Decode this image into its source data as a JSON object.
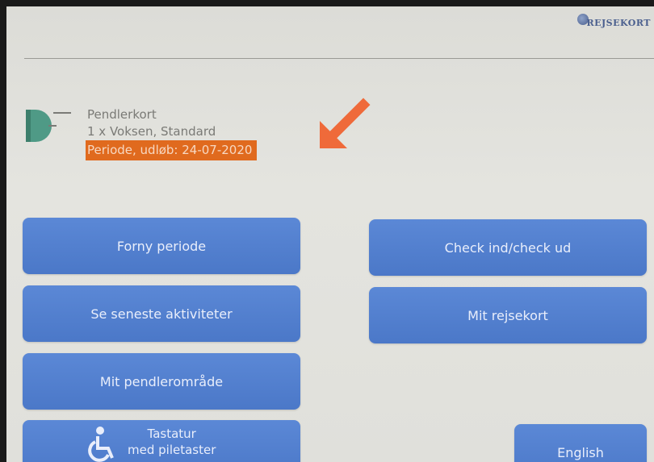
{
  "header": {
    "logo_text": "REJSEKORT"
  },
  "card": {
    "line1": "Pendlerkort",
    "line2": "1 x Voksen, Standard",
    "period": "Periode, udløb: 24-07-2020"
  },
  "buttons": {
    "forny": "Forny periode",
    "check": "Check ind/check ud",
    "aktiviteter": "Se seneste aktiviteter",
    "mit_rejsekort": "Mit rejsekort",
    "pendlerområde": "Mit pendlerområde",
    "tastatur_line1": "Tastatur",
    "tastatur_line2": "med piletaster",
    "english": "English"
  },
  "colors": {
    "button_blue": "#5b88d6",
    "highlight_orange": "#e06a1e",
    "arrow_orange": "#ef6a3a"
  },
  "icons": {
    "card": "card-icon",
    "arrow": "arrow-icon",
    "accessibility": "wheelchair-icon"
  }
}
